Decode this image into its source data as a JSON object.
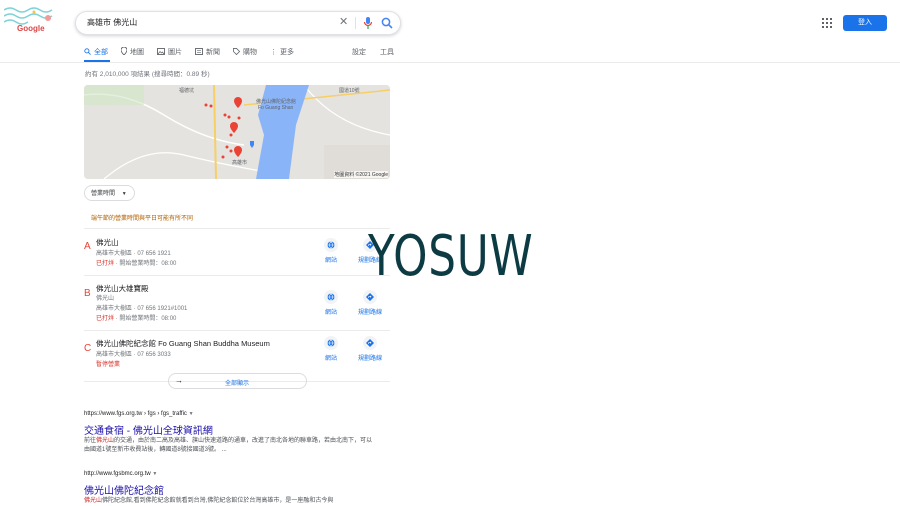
{
  "header": {
    "doodle_alt": "Google",
    "search_query": "高雄市 佛光山",
    "sign_in": "登入"
  },
  "tabs": [
    {
      "label": "全部",
      "icon": "search-icon"
    },
    {
      "label": "地圖",
      "icon": "map-pin-icon"
    },
    {
      "label": "圖片",
      "icon": "image-icon"
    },
    {
      "label": "新聞",
      "icon": "news-icon"
    },
    {
      "label": "購物",
      "icon": "tag-icon"
    },
    {
      "label": "更多",
      "icon": "more-icon"
    }
  ],
  "tools": {
    "settings": "設定",
    "tools": "工具"
  },
  "stats": "約有 2,010,000 項結果 (搜尋時間：0.89 秒)",
  "map": {
    "labels": [
      "福德坑",
      "佛光山佛陀紀念館",
      "Fo Guang Shan",
      "國道10號",
      "高雄市"
    ],
    "copyright": "地圖資料 ©2021 Google"
  },
  "filter": {
    "hours": "營業時間"
  },
  "notice": "端午節的營業時間與平日可能有所不同",
  "places": [
    {
      "letter": "A",
      "name": "佛光山",
      "category": "",
      "address": "高雄市大樹區 · 07 656 1921",
      "status": "已打烊",
      "hours": " · 開始營業時間：08:00"
    },
    {
      "letter": "B",
      "name": "佛光山大雄寶殿",
      "category": "佛光山",
      "address": "高雄市大樹區 · 07 656 1921#1001",
      "status": "已打烊",
      "hours": " · 開始營業時間：08:00"
    },
    {
      "letter": "C",
      "name": "佛光山佛陀紀念館 Fo Guang Shan Buddha Museum",
      "category": "",
      "address": "高雄市大樹區 · 07 656 3033",
      "status": "暫停營業",
      "hours": ""
    }
  ],
  "actions": {
    "website": "網站",
    "directions": "規劃路線"
  },
  "view_all": "全部顯示",
  "results": [
    {
      "url": "https://www.fgs.org.tw › fgs › fgs_traffic",
      "title": "交通食宿 - 佛光山全球資訊網",
      "snippet_pre": "前往",
      "snippet_hl": "佛光山",
      "snippet_post": "的交通，由於南二高及高雄、旗山快速道路的通車，改進了南北各地的聯車路，若由北南下，可以由國道1號至新市收費站後，轉國道8號接國道3號。 ..."
    },
    {
      "url": "http://www.fgsbmc.org.tw",
      "title": "佛光山佛陀紀念館",
      "snippet_pre": "",
      "snippet_hl": "佛光山",
      "snippet_post": "佛陀紀念館,看到佛陀紀念館就看到台灣,佛陀紀念館位於台灣高雄市，是一座融和古今與"
    }
  ],
  "watermark": "YOSUW",
  "colors": {
    "accent": "#1a73e8",
    "link": "#1a0dab",
    "closed": "#d93025",
    "marker": "#ea4335"
  }
}
